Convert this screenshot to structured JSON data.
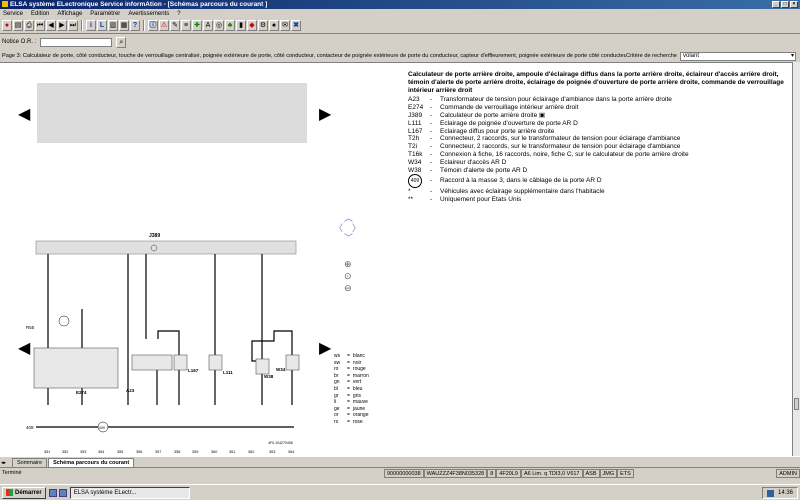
{
  "window": {
    "title": "ELSA système ELectronique Service informAtion - [Schémas parcours du courant ]"
  },
  "menu": [
    "Service",
    "Edition",
    "Affichage",
    "Paramétrer",
    "Avertissements",
    "?"
  ],
  "notice": {
    "label": "Notice O.R. :",
    "value": ""
  },
  "page_bar": {
    "text": "Page 3: Calculateur de porte, côté conducteur, touche de verrouillage centralisé, poignée extérieure de porte, côté conducteur, contacteur de poignée extérieure de porte du conducteur, capteur d'effleurement, poignée extérieure de porte côté conducteur",
    "criteria_label": "Critère de recherche",
    "criteria_value": "volant"
  },
  "doc": {
    "title": "Calculateur de porte arrière droite, ampoule d'éclairage diffus dans la porte arrière droite, éclaireur d'accès arrière droit, témoin d'alerte de porte arrière droite, éclairage de poignée d'ouverture de porte arrière droite, commande de verrouillage intérieur arrière droit",
    "legend": [
      {
        "code": "A23",
        "desc": "Transformateur de tension pour éclairage d'ambiance dans la porte arrière droite"
      },
      {
        "code": "E274",
        "desc": "Commande de verrouillage intérieur arrière droit"
      },
      {
        "code": "J389",
        "desc": "Calculateur de porte arrière droite"
      },
      {
        "code": "L111",
        "desc": "Eclairage de poignée d'ouverture de porte AR D"
      },
      {
        "code": "L167",
        "desc": "Eclairage diffus pour porte arrière droite"
      },
      {
        "code": "T2h",
        "desc": "Connecteur, 2 raccords, sur le transformateur de tension pour éclairage d'ambiance"
      },
      {
        "code": "T2i",
        "desc": "Connecteur, 2 raccords, sur le transformateur de tension pour éclairage d'ambiance"
      },
      {
        "code": "T16k",
        "desc": "Connexion à fiche, 16 raccords, noire, fiche C, sur le calculateur de porte arrière droite"
      },
      {
        "code": "W34",
        "desc": "Eclaireur d'accès AR D"
      },
      {
        "code": "W38",
        "desc": "Témoin d'alerte de porte AR D"
      },
      {
        "code": "409",
        "desc": "Raccord à la masse 3, dans le câblage de la porte AR D",
        "circle": true
      },
      {
        "code": "*",
        "desc": "Véhicules avec éclairage supplémentaire dans l'habitacle"
      },
      {
        "code": "**",
        "desc": "Uniquement pour Etats Unis"
      }
    ]
  },
  "wire_colors": [
    {
      "code": "ws",
      "name": "blanc"
    },
    {
      "code": "sw",
      "name": "noir"
    },
    {
      "code": "ro",
      "name": "rouge"
    },
    {
      "code": "br",
      "name": "marron"
    },
    {
      "code": "gn",
      "name": "vert"
    },
    {
      "code": "bl",
      "name": "bleu"
    },
    {
      "code": "gr",
      "name": "gris"
    },
    {
      "code": "li",
      "name": "mauve"
    },
    {
      "code": "ge",
      "name": "jaune"
    },
    {
      "code": "or",
      "name": "orange"
    },
    {
      "code": "rs",
      "name": "rose"
    }
  ],
  "diagram": {
    "module": "J389",
    "components": [
      "E274",
      "A23",
      "L167",
      "L111",
      "W38",
      "W34"
    ],
    "ground": "409",
    "r55": "R55",
    "ref": "4F0-104270406",
    "bottom_numbers": [
      "351",
      "352",
      "353",
      "354",
      "355",
      "356",
      "357",
      "358",
      "359",
      "360",
      "361",
      "362",
      "363",
      "364"
    ]
  },
  "tabs": [
    "Sommaire",
    "Schéma parcours du courant"
  ],
  "status": {
    "left": "Terminé",
    "fields": [
      "90000000038",
      "WAUZZZ4F38N035328",
      "8",
      "4F20L9",
      "A6 Lim. q TDI3,0 V617",
      "ASB",
      "JMG",
      "ETS"
    ],
    "user": "ADMIN"
  },
  "taskbar": {
    "start": "Démarrer",
    "item": "ELSA système ELectr...",
    "time": "14:36"
  }
}
